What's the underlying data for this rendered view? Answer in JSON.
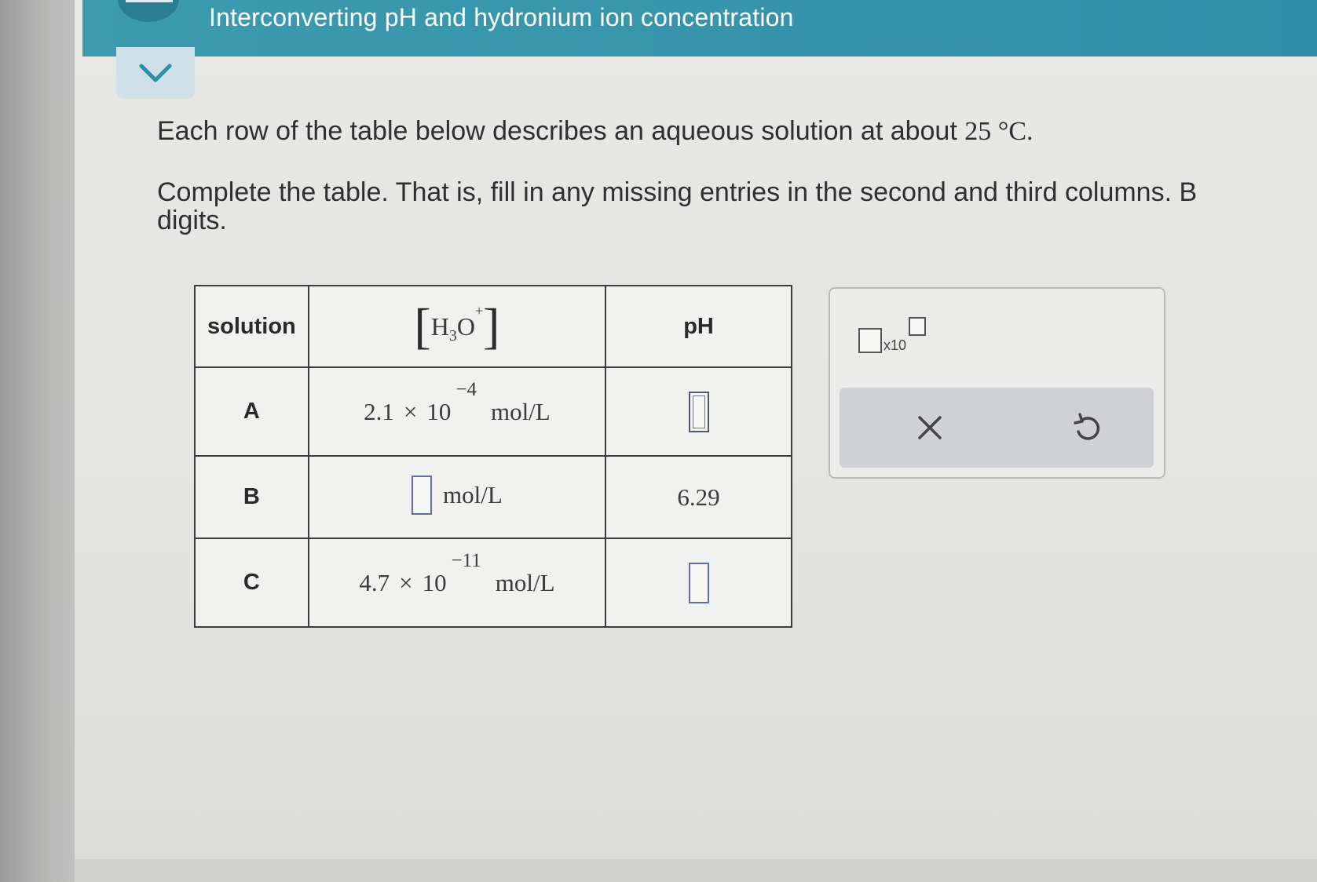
{
  "header": {
    "title": "Interconverting pH and hydronium ion concentration"
  },
  "instructions": {
    "line1_prefix": "Each row of the table below describes an aqueous solution at about ",
    "line1_value": "25 °C.",
    "line2": "Complete the table. That is, fill in any missing entries in the second and third columns. B",
    "line3": "digits."
  },
  "table": {
    "headers": {
      "solution": "solution",
      "h3o_species": "H",
      "h3o_sub": "3",
      "h3o_o": "O",
      "h3o_sup": "+",
      "ph": "pH"
    },
    "rows": [
      {
        "solution": "A",
        "h3o_mantissa": "2.1",
        "h3o_times": "×",
        "h3o_base": "10",
        "h3o_exponent": "−4",
        "h3o_unit": "mol/L",
        "ph_value": ""
      },
      {
        "solution": "B",
        "h3o_value": "",
        "h3o_unit": "mol/L",
        "ph_value": "6.29"
      },
      {
        "solution": "C",
        "h3o_mantissa": "4.7",
        "h3o_times": "×",
        "h3o_base": "10",
        "h3o_exponent": "−11",
        "h3o_unit": "mol/L",
        "ph_value": ""
      }
    ]
  },
  "tool_panel": {
    "sci_notation_label": "x10",
    "icons": {
      "clear": "close-icon",
      "undo": "undo-icon"
    }
  },
  "colors": {
    "header_bar": "#2f8fa8",
    "answer_box_border": "#5c6ea6"
  }
}
